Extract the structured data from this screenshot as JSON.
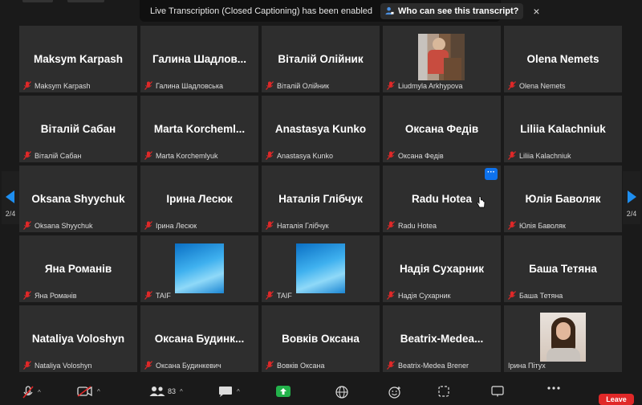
{
  "banner": {
    "message": "Live Transcription (Closed Captioning) has been enabled",
    "button_label": "Who can see this transcript?",
    "close_label": "×"
  },
  "nav": {
    "left_page": "2/4",
    "right_page": "2/4"
  },
  "tiles": [
    {
      "name": "Maksym Karpash",
      "label": "Maksym Karpash"
    },
    {
      "name": "Галина  Шадлов...",
      "label": "Галина Шадловська"
    },
    {
      "name": "Віталій Олійник",
      "label": "Віталій Олійник"
    },
    {
      "name": "",
      "label": "Liudmyla Arkhypova"
    },
    {
      "name": "Olena Nemets",
      "label": "Olena Nemets"
    },
    {
      "name": "Віталій Сабан",
      "label": "Віталій Сабан"
    },
    {
      "name": "Marta  Korcheml...",
      "label": "Marta Korchemlyuk"
    },
    {
      "name": "Anastasya Kunko",
      "label": "Anastasya Kunko"
    },
    {
      "name": "Оксана Федів",
      "label": "Оксана Федів"
    },
    {
      "name": "Liliia Kalachniuk",
      "label": "Liliia Kalachniuk"
    },
    {
      "name": "Oksana Shyychuk",
      "label": "Oksana Shyychuk"
    },
    {
      "name": "Ірина Лесюк",
      "label": "Ірина Лесюк"
    },
    {
      "name": "Наталія Глібчук",
      "label": "Наталія Глібчук"
    },
    {
      "name": "Radu Hotea",
      "label": "Radu Hotea"
    },
    {
      "name": "Юлія Баволяк",
      "label": "Юлія Баволяк"
    },
    {
      "name": "Яна Романів",
      "label": "Яна Романів"
    },
    {
      "name": "",
      "label": "TAIF"
    },
    {
      "name": "",
      "label": "TAIF"
    },
    {
      "name": "Надія Сухарник",
      "label": "Надія Сухарник"
    },
    {
      "name": "Баша Тетяна",
      "label": "Баша Тетяна"
    },
    {
      "name": "Nataliya Voloshyn",
      "label": "Nataliya Voloshyn"
    },
    {
      "name": "Оксана  Будинк...",
      "label": "Оксана Будинкевич"
    },
    {
      "name": "Вовків Оксана",
      "label": "Вовків Оксана"
    },
    {
      "name": "Beatrix-Medea...",
      "label": "Beatrix-Medea Brener"
    },
    {
      "name": "",
      "label": "Ірина Пітух"
    }
  ],
  "tile_more_label": "···",
  "toolbar": {
    "participants_count": "83",
    "leave_label": "Leave"
  },
  "colors": {
    "accent": "#0e72ed",
    "muted_mic": "#e02828",
    "tile_bg": "#2e2e2e",
    "share_green": "#23b24b"
  }
}
